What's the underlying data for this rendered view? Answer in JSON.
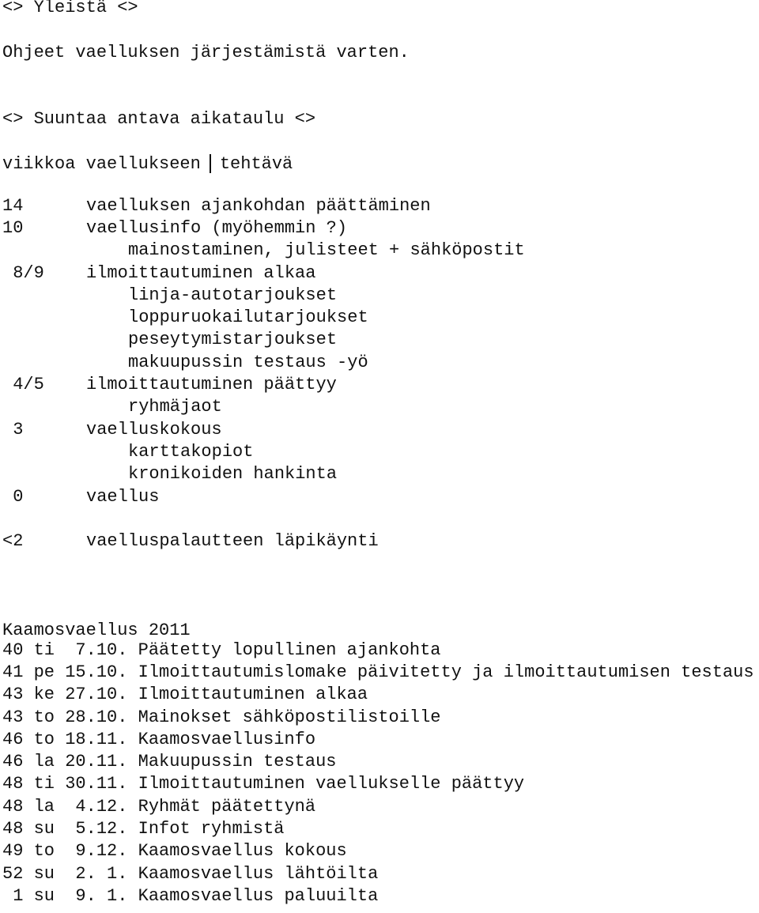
{
  "section_general": {
    "heading": "<> Yleistä <>",
    "intro": "Ohjeet vaelluksen järjestämistä varten."
  },
  "section_schedule": {
    "heading": "<> Suuntaa antava aikataulu <>",
    "header_left": "viikkoa vaellukseen",
    "header_right": "tehtävä",
    "rows": [
      {
        "week": "14",
        "task": "vaelluksen ajankohdan päättäminen",
        "indent": false
      },
      {
        "week": "10",
        "task": "vaellusinfo (myöhemmin ?)",
        "indent": false
      },
      {
        "week": "",
        "task": "mainostaminen, julisteet + sähköpostit",
        "indent": true
      },
      {
        "week": " 8/9",
        "task": "ilmoittautuminen alkaa",
        "indent": false
      },
      {
        "week": "",
        "task": "linja-autotarjoukset",
        "indent": true
      },
      {
        "week": "",
        "task": "loppuruokailutarjoukset",
        "indent": true
      },
      {
        "week": "",
        "task": "peseytymistarjoukset",
        "indent": true
      },
      {
        "week": "",
        "task": "makuupussin testaus -yö",
        "indent": true
      },
      {
        "week": " 4/5",
        "task": "ilmoittautuminen päättyy",
        "indent": false
      },
      {
        "week": "",
        "task": "ryhmäjaot",
        "indent": true
      },
      {
        "week": " 3",
        "task": "vaelluskokous",
        "indent": false
      },
      {
        "week": "",
        "task": "karttakopiot",
        "indent": true
      },
      {
        "week": "",
        "task": "kronikoiden hankinta",
        "indent": true
      },
      {
        "week": " 0",
        "task": "vaellus",
        "indent": false
      }
    ],
    "after_row": {
      "week": "<2",
      "task": "vaelluspalautteen läpikäynti"
    }
  },
  "section_event": {
    "title": "Kaamosvaellus 2011",
    "entries": [
      {
        "week": "40",
        "day": "ti",
        "date": " 7.10.",
        "text": "Päätetty lopullinen ajankohta"
      },
      {
        "week": "41",
        "day": "pe",
        "date": "15.10.",
        "text": "Ilmoittautumislomake päivitetty ja ilmoittautumisen testaus"
      },
      {
        "week": "43",
        "day": "ke",
        "date": "27.10.",
        "text": "Ilmoittautuminen alkaa"
      },
      {
        "week": "43",
        "day": "to",
        "date": "28.10.",
        "text": "Mainokset sähköpostilistoille"
      },
      {
        "week": "46",
        "day": "to",
        "date": "18.11.",
        "text": "Kaamosvaellusinfo"
      },
      {
        "week": "46",
        "day": "la",
        "date": "20.11.",
        "text": "Makuupussin testaus"
      },
      {
        "week": "48",
        "day": "ti",
        "date": "30.11.",
        "text": "Ilmoittautuminen vaellukselle päättyy"
      },
      {
        "week": "48",
        "day": "la",
        "date": " 4.12.",
        "text": "Ryhmät päätettynä"
      },
      {
        "week": "48",
        "day": "su",
        "date": " 5.12.",
        "text": "Infot ryhmistä"
      },
      {
        "week": "49",
        "day": "to",
        "date": " 9.12.",
        "text": "Kaamosvaellus kokous"
      },
      {
        "week": "52",
        "day": "su",
        "date": " 2. 1.",
        "text": "Kaamosvaellus lähtöilta"
      },
      {
        "week": " 1",
        "day": "su",
        "date": " 9. 1.",
        "text": "Kaamosvaellus paluuilta"
      }
    ]
  }
}
